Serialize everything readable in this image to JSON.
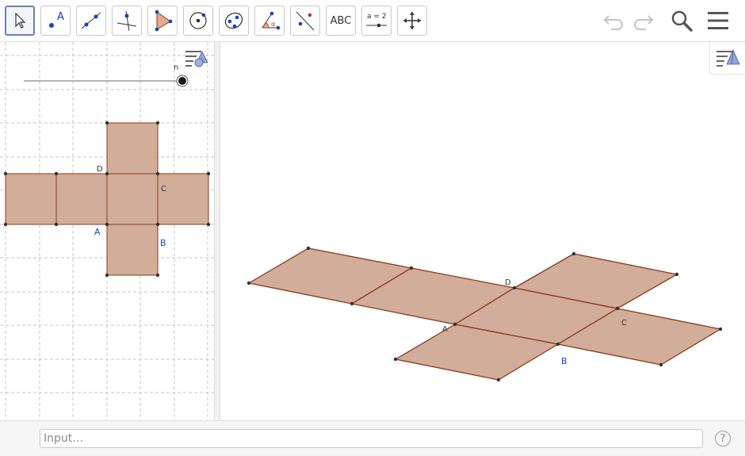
{
  "toolbar": {
    "tools": [
      {
        "name": "move-tool",
        "selected": true
      },
      {
        "name": "point-tool"
      },
      {
        "name": "line-tool"
      },
      {
        "name": "perpendicular-line-tool"
      },
      {
        "name": "polygon-tool"
      },
      {
        "name": "circle-tool"
      },
      {
        "name": "conic-tool"
      },
      {
        "name": "angle-tool"
      },
      {
        "name": "reflect-tool"
      },
      {
        "name": "text-tool",
        "label": "ABC"
      },
      {
        "name": "slider-tool",
        "label": "a = 2"
      },
      {
        "name": "move-graphics-tool"
      }
    ],
    "point_tool_label": "A",
    "undo_icon": "undo-icon",
    "redo_icon": "redo-icon",
    "search_icon": "search-icon",
    "menu_icon": "hamburger-menu-icon"
  },
  "left_view": {
    "slider": {
      "label": "n",
      "value_fraction": 1.0
    },
    "points": {
      "A": "A",
      "B": "B",
      "C": "C",
      "D": "D"
    }
  },
  "right_view": {
    "points": {
      "A": "A",
      "B": "B",
      "C": "C",
      "D": "D"
    }
  },
  "colors": {
    "face_fill": "#c9a08a",
    "face_stroke": "#8b3a1e",
    "point": "#333333",
    "label_blue": "#1c3ec0",
    "label_dark": "#333333",
    "grid": "#b8b8b8"
  },
  "input_bar": {
    "placeholder": "Input…",
    "help_label": "?"
  }
}
